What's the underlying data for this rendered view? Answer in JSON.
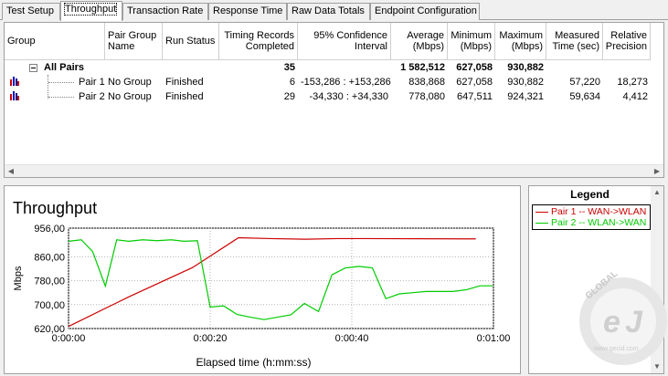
{
  "tabs": [
    {
      "label": "Test Setup",
      "active": false
    },
    {
      "label": "Throughput",
      "active": true
    },
    {
      "label": "Transaction Rate",
      "active": false
    },
    {
      "label": "Response Time",
      "active": false
    },
    {
      "label": "Raw Data Totals",
      "active": false
    },
    {
      "label": "Endpoint Configuration",
      "active": false
    }
  ],
  "table": {
    "columns": [
      {
        "key": "group",
        "label": "Group"
      },
      {
        "key": "pair_group_name",
        "label": "Pair Group Name"
      },
      {
        "key": "run_status",
        "label": "Run Status"
      },
      {
        "key": "timing_records",
        "label": "Timing Records Completed"
      },
      {
        "key": "confidence",
        "label": "95% Confidence Interval"
      },
      {
        "key": "average",
        "label": "Average (Mbps)"
      },
      {
        "key": "minimum",
        "label": "Minimum (Mbps)"
      },
      {
        "key": "maximum",
        "label": "Maximum (Mbps)"
      },
      {
        "key": "measured_time",
        "label": "Measured Time (sec)"
      },
      {
        "key": "relative_precision",
        "label": "Relative Precision"
      }
    ],
    "summary": {
      "group": "All Pairs",
      "timing_records": "35",
      "average": "1 582,512",
      "minimum": "627,058",
      "maximum": "930,882"
    },
    "rows": [
      {
        "group": "Pair 1",
        "pair_group_name": "No Group",
        "run_status": "Finished",
        "timing_records": "6",
        "confidence": "-153,286 : +153,286",
        "average": "838,868",
        "minimum": "627,058",
        "maximum": "930,882",
        "measured_time": "57,220",
        "relative_precision": "18,273"
      },
      {
        "group": "Pair 2",
        "pair_group_name": "No Group",
        "run_status": "Finished",
        "timing_records": "29",
        "confidence": "-34,330 : +34,330",
        "average": "778,080",
        "minimum": "647,511",
        "maximum": "924,321",
        "measured_time": "59,634",
        "relative_precision": "4,412"
      }
    ]
  },
  "legend": {
    "title": "Legend",
    "items": [
      {
        "label": "Pair 1 -- WAN->WLAN",
        "color": "#cc0000"
      },
      {
        "label": "Pair 2 -- WLAN->WAN",
        "color": "#00cc00"
      }
    ]
  },
  "watermark": {
    "brand": "GLOBAL",
    "site": "www.gecid.com"
  },
  "chart_data": {
    "type": "line",
    "title": "Throughput",
    "xlabel": "Elapsed time (h:mm:ss)",
    "ylabel": "Mbps",
    "xlim": [
      0,
      60
    ],
    "ylim": [
      620,
      956
    ],
    "x_tick_values": [
      0,
      20,
      40,
      60
    ],
    "x_tick_labels": [
      "0:00:00",
      "0:00:20",
      "0:00:40",
      "0:01:00"
    ],
    "y_tick_values": [
      620,
      700,
      780,
      860,
      956
    ],
    "y_tick_labels": [
      "620,00",
      "700,00",
      "780,00",
      "860,00",
      "956,00"
    ],
    "grid": true,
    "legend_position": "right",
    "series": [
      {
        "name": "Pair 1 -- WAN->WLAN",
        "color": "#cc0000",
        "x": [
          0,
          8.5,
          17.5,
          24,
          28.5,
          33.5,
          38,
          42,
          57.5
        ],
        "y": [
          627,
          726,
          824,
          924,
          921,
          919,
          921,
          921,
          920
        ]
      },
      {
        "name": "Pair 2 -- WLAN->WAN",
        "color": "#00cc00",
        "x": [
          0,
          1.8,
          3.4,
          5.2,
          6.8,
          8.5,
          10.5,
          12.5,
          14.5,
          16.3,
          18.2,
          20.0,
          21.9,
          23.8,
          25.7,
          27.6,
          29.5,
          31.4,
          33.3,
          35.3,
          37.2,
          39.1,
          41.0,
          42.9,
          44.8,
          46.7,
          48.6,
          50.5,
          52.4,
          54.3,
          56.2,
          58.1,
          59.9
        ],
        "y": [
          912,
          917,
          878,
          762,
          917,
          912,
          917,
          914,
          917,
          912,
          914,
          692,
          696,
          667,
          658,
          650,
          658,
          666,
          704,
          677,
          800,
          823,
          828,
          823,
          720,
          736,
          740,
          744,
          744,
          744,
          750,
          763,
          763
        ]
      }
    ]
  }
}
